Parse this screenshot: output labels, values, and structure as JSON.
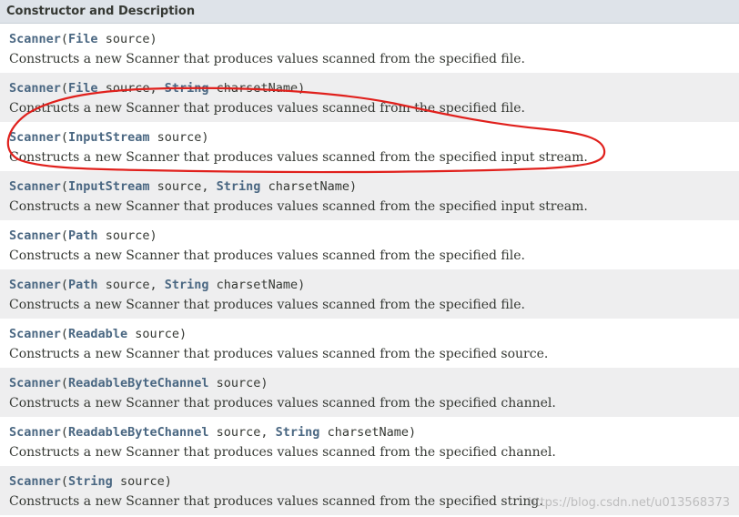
{
  "header": {
    "title": "Constructor and Description"
  },
  "rows": [
    {
      "ctor": "Scanner",
      "params": [
        {
          "type": "File",
          "name": "source"
        }
      ],
      "desc": "Constructs a new Scanner that produces values scanned from the specified file."
    },
    {
      "ctor": "Scanner",
      "params": [
        {
          "type": "File",
          "name": "source"
        },
        {
          "type": "String",
          "name": "charsetName"
        }
      ],
      "desc": "Constructs a new Scanner that produces values scanned from the specified file."
    },
    {
      "ctor": "Scanner",
      "params": [
        {
          "type": "InputStream",
          "name": "source"
        }
      ],
      "desc": "Constructs a new Scanner that produces values scanned from the specified input stream."
    },
    {
      "ctor": "Scanner",
      "params": [
        {
          "type": "InputStream",
          "name": "source"
        },
        {
          "type": "String",
          "name": "charsetName"
        }
      ],
      "desc": "Constructs a new Scanner that produces values scanned from the specified input stream."
    },
    {
      "ctor": "Scanner",
      "params": [
        {
          "type": "Path",
          "name": "source"
        }
      ],
      "desc": "Constructs a new Scanner that produces values scanned from the specified file."
    },
    {
      "ctor": "Scanner",
      "params": [
        {
          "type": "Path",
          "name": "source"
        },
        {
          "type": "String",
          "name": "charsetName"
        }
      ],
      "desc": "Constructs a new Scanner that produces values scanned from the specified file."
    },
    {
      "ctor": "Scanner",
      "params": [
        {
          "type": "Readable",
          "name": "source"
        }
      ],
      "desc": "Constructs a new Scanner that produces values scanned from the specified source."
    },
    {
      "ctor": "Scanner",
      "params": [
        {
          "type": "ReadableByteChannel",
          "name": "source"
        }
      ],
      "desc": "Constructs a new Scanner that produces values scanned from the specified channel."
    },
    {
      "ctor": "Scanner",
      "params": [
        {
          "type": "ReadableByteChannel",
          "name": "source"
        },
        {
          "type": "String",
          "name": "charsetName"
        }
      ],
      "desc": "Constructs a new Scanner that produces values scanned from the specified channel."
    },
    {
      "ctor": "Scanner",
      "params": [
        {
          "type": "String",
          "name": "source"
        }
      ],
      "desc": "Constructs a new Scanner that produces values scanned from the specified string."
    }
  ],
  "watermark": "https://blog.csdn.net/u013568373",
  "colors": {
    "header_bg": "#dee3e9",
    "row_alt_bg": "#eeeeef",
    "link": "#4a6782",
    "text": "#353833",
    "annotation": "#e0201c"
  }
}
